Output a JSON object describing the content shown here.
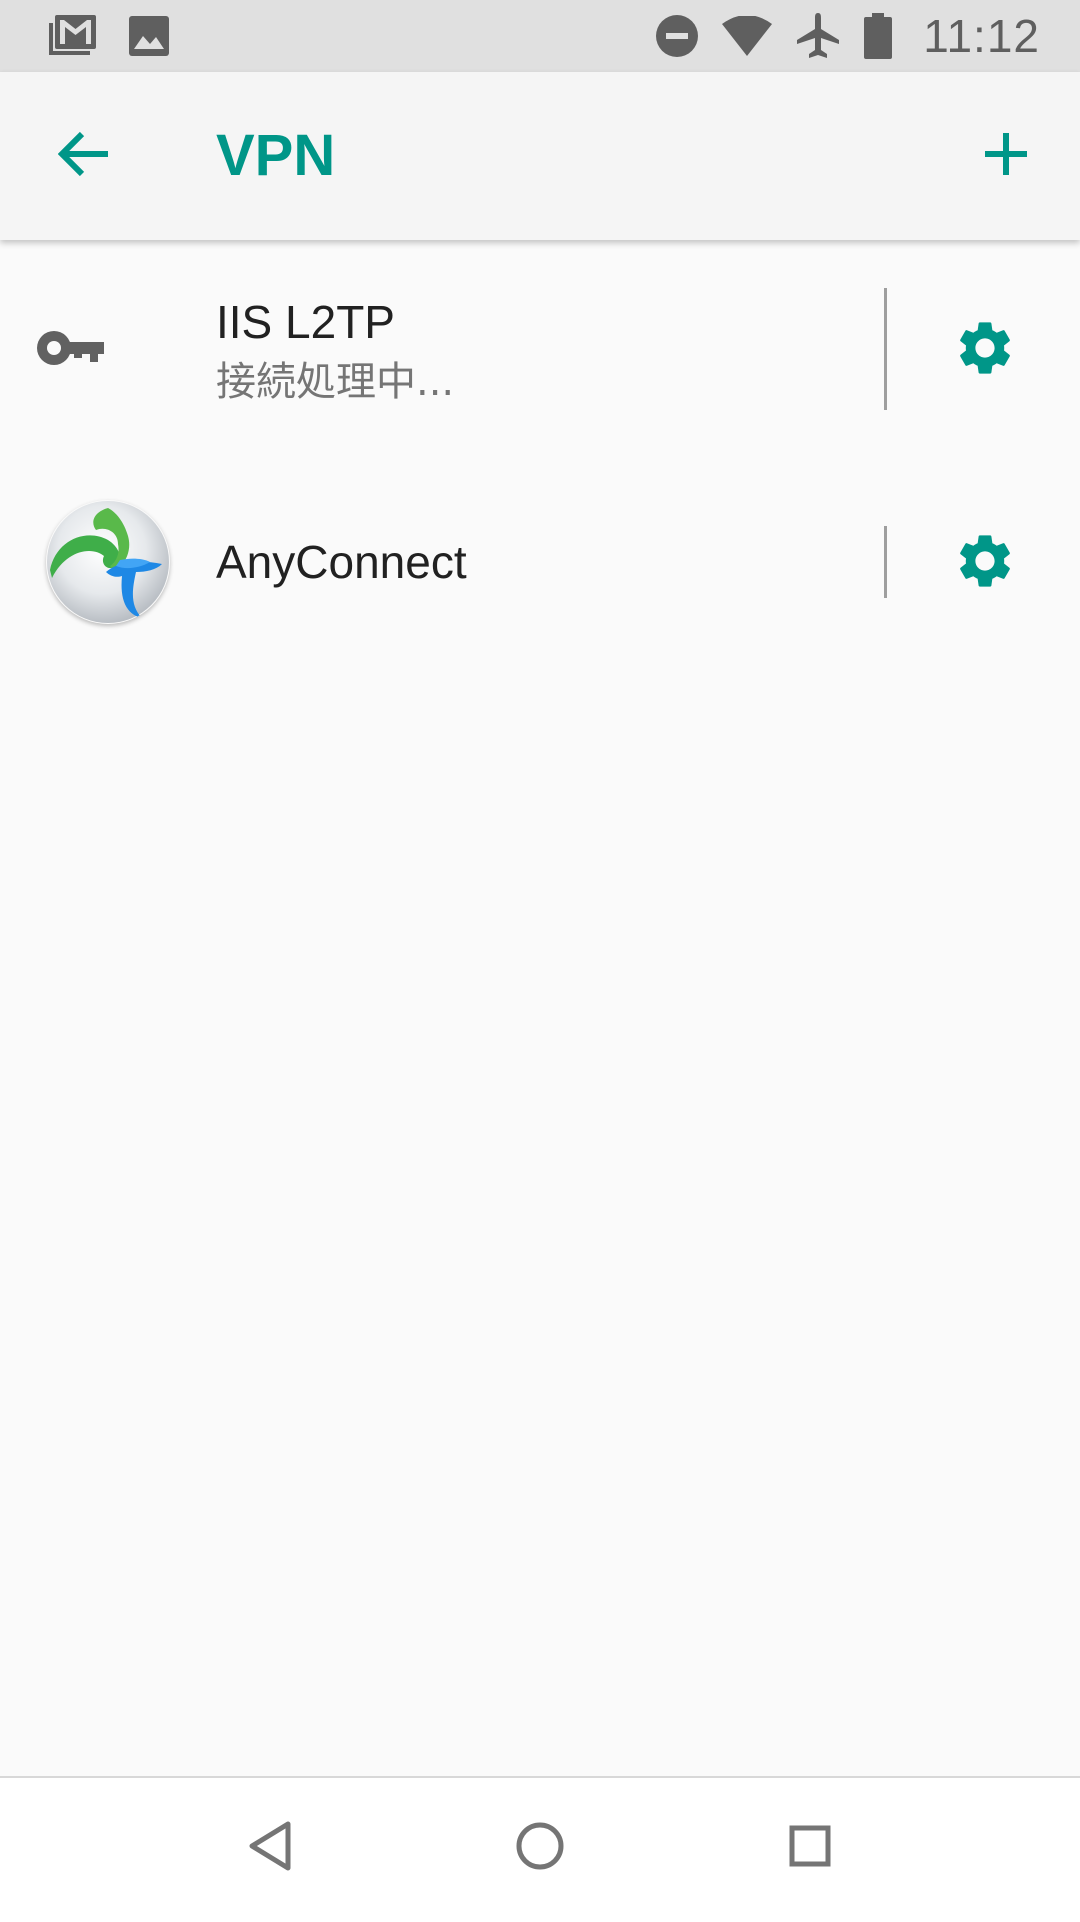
{
  "status_bar": {
    "time": "11:12",
    "left_icons": [
      "gmail-icon",
      "image-icon"
    ],
    "right_icons": [
      "do-not-disturb-icon",
      "wifi-icon",
      "airplane-icon",
      "battery-icon"
    ]
  },
  "app_bar": {
    "title": "VPN",
    "back_icon": "arrow-back-icon",
    "add_icon": "plus-icon"
  },
  "vpn_list": [
    {
      "name": "IIS L2TP",
      "status": "接続処理中...",
      "icon": "key-icon",
      "action_icon": "gear-icon"
    },
    {
      "name": "AnyConnect",
      "icon": "anyconnect-app-icon",
      "action_icon": "gear-icon"
    }
  ],
  "nav_bar": {
    "icons": [
      "nav-back-icon",
      "nav-home-icon",
      "nav-recents-icon"
    ]
  },
  "colors": {
    "accent": "#009688",
    "status_bar_bg": "#e0e0e0",
    "app_bar_bg": "#f5f5f5",
    "page_bg": "#fafafa",
    "primary_text": "#212121",
    "secondary_text": "#757575",
    "icon_gray": "#616161"
  }
}
